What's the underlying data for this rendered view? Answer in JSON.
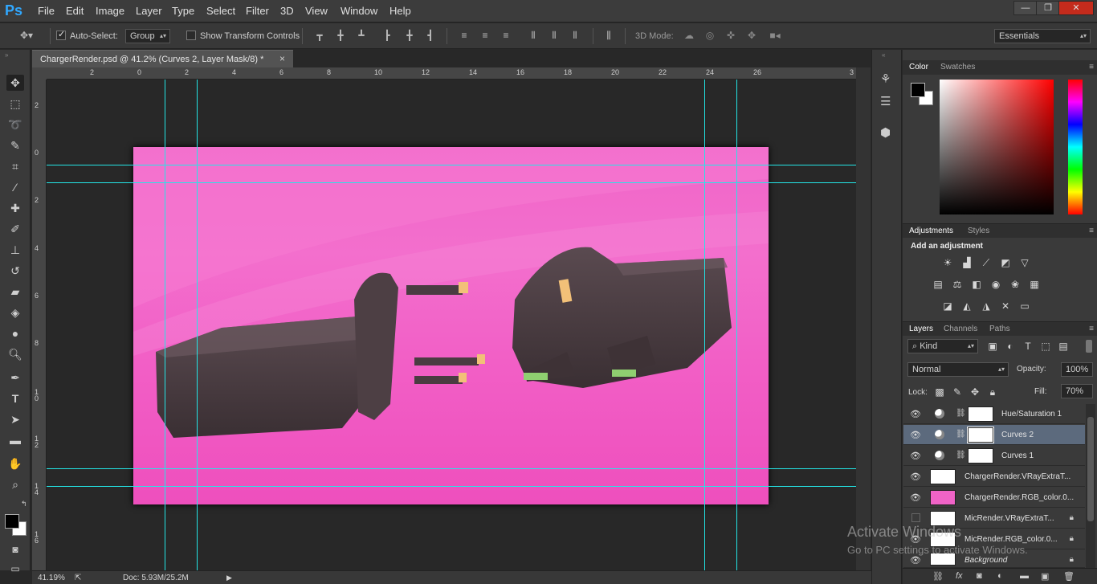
{
  "app": {
    "logo": "Ps"
  },
  "menu": [
    "File",
    "Edit",
    "Image",
    "Layer",
    "Type",
    "Select",
    "Filter",
    "3D",
    "View",
    "Window",
    "Help"
  ],
  "window_controls": {
    "minimize": "—",
    "restore": "❐",
    "close": "✕"
  },
  "options_bar": {
    "auto_select_label": "Auto-Select:",
    "auto_select_checked": true,
    "auto_select_value": "Group",
    "show_transform_label": "Show Transform Controls",
    "show_transform_checked": false,
    "mode_3d_label": "3D Mode:",
    "workspace": "Essentials"
  },
  "document": {
    "tab_title": "ChargerRender.psd @ 41.2% (Curves 2, Layer Mask/8) *",
    "close": "×",
    "zoom": "41.19%",
    "doc_info": "Doc: 5.93M/25.2M",
    "ruler_top": [
      "2",
      "0",
      "2",
      "4",
      "6",
      "8",
      "10",
      "12",
      "14",
      "16",
      "18",
      "20",
      "22",
      "24",
      "26",
      "3"
    ],
    "ruler_left": [
      "2",
      "0",
      "2",
      "4",
      "6",
      "8",
      "1 0",
      "1 2",
      "1 4",
      "1 6"
    ],
    "background_color": "#f063c7"
  },
  "color_panel": {
    "tabs": [
      "Color",
      "Swatches"
    ],
    "foreground": "#000000",
    "background": "#ffffff"
  },
  "adjustments_panel": {
    "tabs": [
      "Adjustments",
      "Styles"
    ],
    "title": "Add an adjustment"
  },
  "layers_panel": {
    "tabs": [
      "Layers",
      "Channels",
      "Paths"
    ],
    "filter": "Kind",
    "blend_mode": "Normal",
    "opacity_label": "Opacity:",
    "opacity": "100%",
    "lock_label": "Lock:",
    "fill_label": "Fill:",
    "fill": "70%",
    "layers": [
      {
        "name": "Hue/Saturation 1",
        "type": "adjustment",
        "visible": true,
        "selected": false
      },
      {
        "name": "Curves 2",
        "type": "adjustment",
        "visible": true,
        "selected": true
      },
      {
        "name": "Curves 1",
        "type": "adjustment",
        "visible": true,
        "selected": false
      },
      {
        "name": "ChargerRender.VRayExtraT...",
        "type": "smart",
        "visible": true,
        "selected": false
      },
      {
        "name": "ChargerRender.RGB_color.0...",
        "type": "smart",
        "visible": true,
        "selected": false
      },
      {
        "name": "MicRender.VRayExtraT...",
        "type": "smart",
        "visible": false,
        "selected": false
      },
      {
        "name": "MicRender.RGB_color.0...",
        "type": "smart",
        "visible": true,
        "selected": false
      },
      {
        "name": "Background",
        "type": "background",
        "visible": true,
        "selected": false
      }
    ]
  },
  "watermark": {
    "line1": "Activate Windows",
    "line2": "Go to PC settings to activate Windows."
  }
}
